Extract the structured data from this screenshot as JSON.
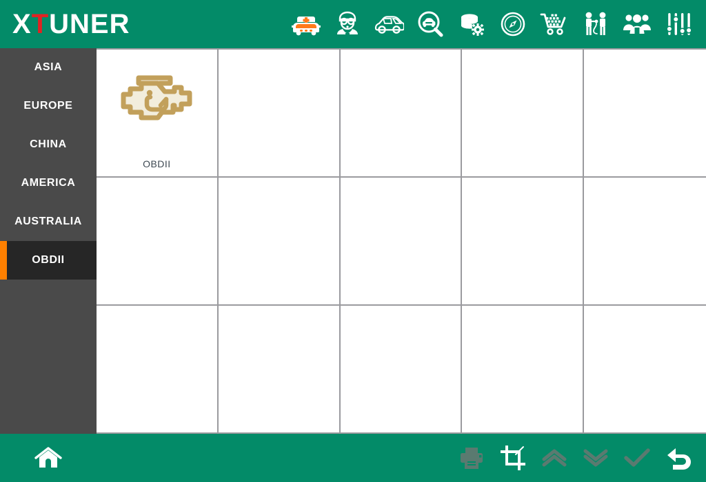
{
  "app": {
    "brand_prefix": "X",
    "brand_accent": "T",
    "brand_suffix": "UNER",
    "header_color": "#038b68",
    "accent_color": "#ff8000",
    "brand_accent_color": "#e02323",
    "sidebar_color": "#4a4a4a",
    "sidebar_selected_color": "#262626",
    "grid_line_color": "#9a9a9e"
  },
  "header": {
    "tools": [
      {
        "name": "ambulance-icon",
        "label": "Service"
      },
      {
        "name": "expert-face-icon",
        "label": "Expert"
      },
      {
        "name": "car-icon",
        "label": "Vehicle"
      },
      {
        "name": "car-search-icon",
        "label": "Diagnose"
      },
      {
        "name": "database-gear-icon",
        "label": "Data Manage"
      },
      {
        "name": "compass-icon",
        "label": "Navigate"
      },
      {
        "name": "shopping-cart-icon",
        "label": "Store"
      },
      {
        "name": "remote-support-icon",
        "label": "Remote"
      },
      {
        "name": "user-group-icon",
        "label": "Users"
      },
      {
        "name": "sliders-icon",
        "label": "Settings"
      }
    ]
  },
  "sidebar": {
    "items": [
      {
        "label": "ASIA",
        "selected": false
      },
      {
        "label": "EUROPE",
        "selected": false
      },
      {
        "label": "CHINA",
        "selected": false
      },
      {
        "label": "AMERICA",
        "selected": false
      },
      {
        "label": "AUSTRALIA",
        "selected": false
      },
      {
        "label": "OBDII",
        "selected": true
      }
    ]
  },
  "grid": {
    "columns": 5,
    "rows": 3,
    "cells": [
      {
        "label": "OBDII",
        "icon": "check-engine-icon",
        "filled": true
      },
      {
        "label": "",
        "icon": "",
        "filled": false
      },
      {
        "label": "",
        "icon": "",
        "filled": false
      },
      {
        "label": "",
        "icon": "",
        "filled": false
      },
      {
        "label": "",
        "icon": "",
        "filled": false
      },
      {
        "label": "",
        "icon": "",
        "filled": false
      },
      {
        "label": "",
        "icon": "",
        "filled": false
      },
      {
        "label": "",
        "icon": "",
        "filled": false
      },
      {
        "label": "",
        "icon": "",
        "filled": false
      },
      {
        "label": "",
        "icon": "",
        "filled": false
      },
      {
        "label": "",
        "icon": "",
        "filled": false
      },
      {
        "label": "",
        "icon": "",
        "filled": false
      },
      {
        "label": "",
        "icon": "",
        "filled": false
      },
      {
        "label": "",
        "icon": "",
        "filled": false
      },
      {
        "label": "",
        "icon": "",
        "filled": false
      }
    ]
  },
  "footer": {
    "left_tools": [
      {
        "name": "home-icon",
        "label": "Home",
        "enabled": true
      }
    ],
    "right_tools": [
      {
        "name": "printer-icon",
        "label": "Print",
        "enabled": false
      },
      {
        "name": "crop-icon",
        "label": "Screenshot",
        "enabled": true
      },
      {
        "name": "page-up-icon",
        "label": "Page Up",
        "enabled": false
      },
      {
        "name": "page-down-icon",
        "label": "Page Down",
        "enabled": false
      },
      {
        "name": "check-icon",
        "label": "Confirm",
        "enabled": false
      },
      {
        "name": "back-icon",
        "label": "Back",
        "enabled": true
      }
    ]
  }
}
